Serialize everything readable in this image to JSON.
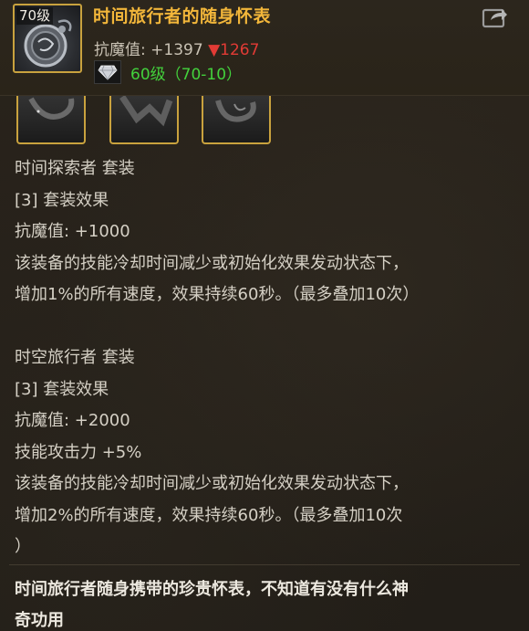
{
  "item": {
    "level_tag": "70级",
    "name": "时间旅行者的随身怀表",
    "stat_label": "抗魔值: ",
    "stat_value": "+1397",
    "stat_down_arrow": "▼",
    "stat_down_value": "1267",
    "requirement": "60级（70-10）",
    "icon": "pocket-watch-icon",
    "gem_icon": "diamond-icon",
    "share_icon": "share-icon"
  },
  "set_slots": [
    {
      "icon": "set-piece-icon-1"
    },
    {
      "icon": "set-piece-icon-2"
    },
    {
      "icon": "set-piece-icon-3"
    }
  ],
  "set_effects": [
    {
      "set_name": "时间探索者  套装",
      "tier": "[3] 套装效果",
      "lines": [
        "抗魔值: +1000",
        "该装备的技能冷却时间减少或初始化效果发动状态下，",
        "增加1%的所有速度，效果持续60秒。（最多叠加10次）"
      ]
    },
    {
      "set_name": "时空旅行者  套装",
      "tier": "[3] 套装效果",
      "lines": [
        "抗魔值: +2000",
        "技能攻击力 +5%",
        "该装备的技能冷却时间减少或初始化效果发动状态下，",
        "增加2%的所有速度，效果持续60秒。（最多叠加10次",
        "）"
      ]
    }
  ],
  "description": [
    "时间旅行者随身携带的珍贵怀表，不知道有没有什么神",
    "奇功用"
  ],
  "colors": {
    "name": "#f2b63a",
    "frame": "#c9a23e",
    "requirement": "#43d13c",
    "down": "#e23b35",
    "text": "#d5d0c5"
  }
}
